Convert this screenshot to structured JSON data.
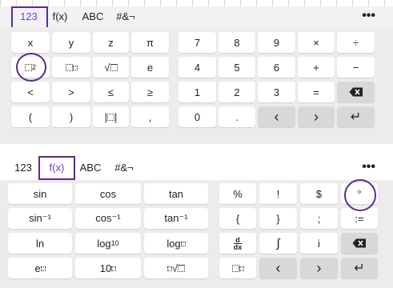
{
  "top_panel": {
    "tabs": [
      "123",
      "f(x)",
      "ABC",
      "#&¬"
    ],
    "active_tab": "123",
    "more_icon": "•••",
    "left_keys": [
      [
        "x",
        "y",
        "z",
        "π"
      ],
      [
        "x²",
        "xⁿ",
        "√x",
        "e"
      ],
      [
        "<",
        ">",
        "≤",
        "≥"
      ],
      [
        "(",
        ")",
        "|x|",
        ","
      ]
    ],
    "key_labels": {
      "square": "2",
      "sqrt": "√"
    },
    "right_keys": [
      [
        "7",
        "8",
        "9",
        "×",
        "÷"
      ],
      [
        "4",
        "5",
        "6",
        "+",
        "−"
      ],
      [
        "1",
        "2",
        "3",
        "=",
        "backspace"
      ],
      [
        "0",
        ".",
        "‹",
        "›",
        "↵"
      ]
    ]
  },
  "bottom_panel": {
    "tabs": [
      "123",
      "f(x)",
      "ABC",
      "#&¬"
    ],
    "active_tab": "f(x)",
    "more_icon": "•••",
    "left_keys": [
      [
        "sin",
        "cos",
        "tan"
      ],
      [
        "sin⁻¹",
        "cos⁻¹",
        "tan⁻¹"
      ],
      [
        "ln",
        "log",
        "log"
      ],
      [
        "e",
        "10",
        "√"
      ]
    ],
    "log_subscript": "10",
    "right_keys": [
      [
        "%",
        "!",
        "$",
        "°"
      ],
      [
        "{",
        "}",
        ";",
        ":="
      ],
      [
        "d/dx",
        "∫",
        "i",
        "backspace"
      ],
      [
        "sub",
        "‹",
        "›",
        "↵"
      ]
    ],
    "deriv": {
      "num": "d",
      "den": "dx"
    }
  }
}
